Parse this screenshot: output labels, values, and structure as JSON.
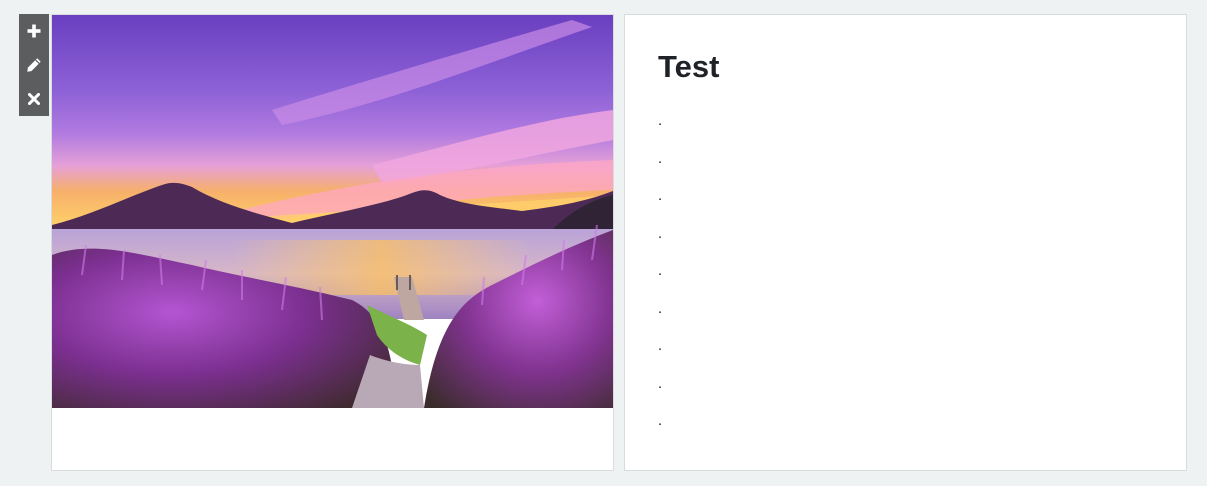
{
  "toolbar": {
    "buttons": [
      {
        "icon": "plus-icon"
      },
      {
        "icon": "pencil-icon"
      },
      {
        "icon": "close-icon"
      }
    ],
    "color": "#5b5d5f"
  },
  "image_card": {
    "image": "sunset lake landscape with volcanoes and purple flowers"
  },
  "text_card": {
    "title": "Test",
    "lines": [
      ".",
      ".",
      ".",
      ".",
      ".",
      ".",
      ".",
      ".",
      "."
    ]
  }
}
